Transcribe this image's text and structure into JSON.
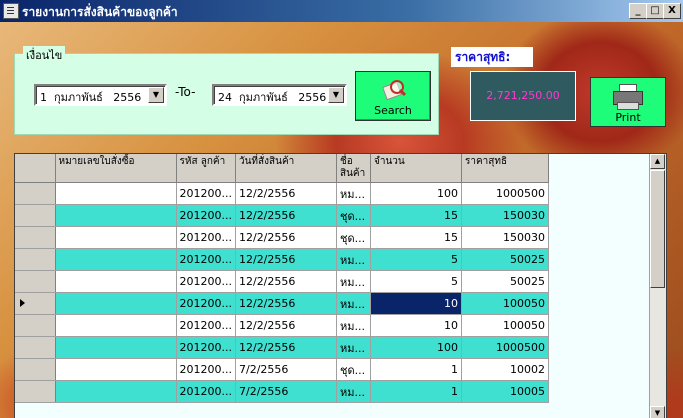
{
  "window": {
    "title": "รายงานการสั่งสินค้าของลูกค้า",
    "buttons": {
      "minimize": "_",
      "maximize": "□",
      "close": "X"
    }
  },
  "filter": {
    "group_label": "เงื่อนไข",
    "from_date": "1  กุมภาพันธ์   2556",
    "to_label": "-To-",
    "to_date": "24  กุมภาพันธ์   2556",
    "search_label": "Search"
  },
  "summary": {
    "price_label": "ราคาสุทธิ:",
    "total_value": "2,721,250.00",
    "print_label": "Print"
  },
  "table": {
    "columns": [
      "หมายเลขใบสั่งซื้อ",
      "รหัส ลูกค้า",
      "วันที่สั่งสินค้า",
      "ชื่อ สินค้า",
      "จำนวน",
      "ราคาสุทธิ"
    ],
    "rows": [
      {
        "order": "",
        "customer": "201200...",
        "date": "12/2/2556",
        "product": "หม...",
        "qty": "100",
        "price": "1000500"
      },
      {
        "order": "",
        "customer": "201200...",
        "date": "12/2/2556",
        "product": "ชุด...",
        "qty": "15",
        "price": "150030"
      },
      {
        "order": "",
        "customer": "201200...",
        "date": "12/2/2556",
        "product": "ชุด...",
        "qty": "15",
        "price": "150030"
      },
      {
        "order": "",
        "customer": "201200...",
        "date": "12/2/2556",
        "product": "หม...",
        "qty": "5",
        "price": "50025"
      },
      {
        "order": "",
        "customer": "201200...",
        "date": "12/2/2556",
        "product": "หม...",
        "qty": "5",
        "price": "50025"
      },
      {
        "order": "",
        "customer": "201200...",
        "date": "12/2/2556",
        "product": "หม...",
        "qty": "10",
        "price": "100050"
      },
      {
        "order": "",
        "customer": "201200...",
        "date": "12/2/2556",
        "product": "หม...",
        "qty": "10",
        "price": "100050"
      },
      {
        "order": "",
        "customer": "201200...",
        "date": "12/2/2556",
        "product": "หม...",
        "qty": "100",
        "price": "1000500"
      },
      {
        "order": "",
        "customer": "201200...",
        "date": "7/2/2556",
        "product": "ชุด...",
        "qty": "1",
        "price": "10002"
      },
      {
        "order": "",
        "customer": "201200...",
        "date": "7/2/2556",
        "product": "หม...",
        "qty": "1",
        "price": "10005"
      }
    ]
  },
  "colors": {
    "accent_green": "#1dfd7a",
    "row_teal": "#40e0d0",
    "selection": "#0a246a",
    "total_text": "#ff3ad0"
  }
}
